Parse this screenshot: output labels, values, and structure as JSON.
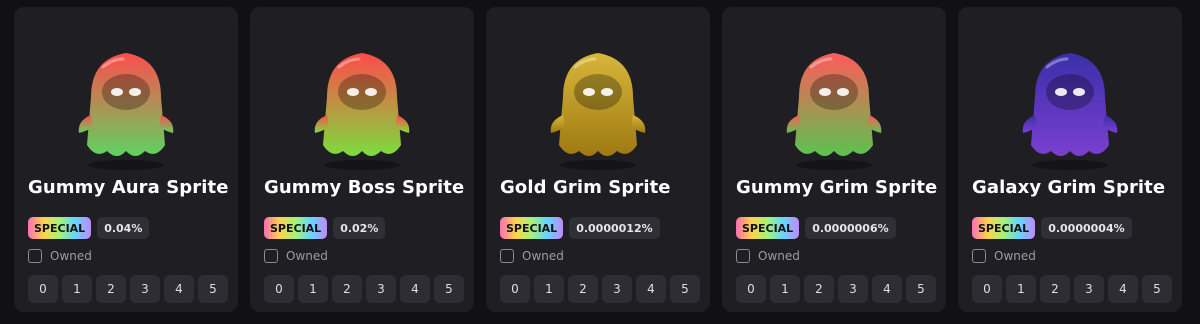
{
  "cards": [
    {
      "name": "Gummy Aura Sprite",
      "badge": "SPECIAL",
      "rarity": "0.04%",
      "owned_label": "Owned",
      "levels": [
        "0",
        "1",
        "2",
        "3",
        "4",
        "5"
      ],
      "art_icon": "gummy-aura-sprite-icon",
      "colors": {
        "top": "#ff4d4d",
        "bottom": "#5fd35f"
      }
    },
    {
      "name": "Gummy Boss Sprite",
      "badge": "SPECIAL",
      "rarity": "0.02%",
      "owned_label": "Owned",
      "levels": [
        "0",
        "1",
        "2",
        "3",
        "4",
        "5"
      ],
      "art_icon": "gummy-boss-sprite-icon",
      "colors": {
        "top": "#ff4a4a",
        "bottom": "#7ddc3d"
      }
    },
    {
      "name": "Gold Grim Sprite",
      "badge": "SPECIAL",
      "rarity": "0.0000012%",
      "owned_label": "Owned",
      "levels": [
        "0",
        "1",
        "2",
        "3",
        "4",
        "5"
      ],
      "art_icon": "gold-grim-sprite-icon",
      "colors": {
        "top": "#d8b63a",
        "bottom": "#9e7a12"
      }
    },
    {
      "name": "Gummy Grim Sprite",
      "badge": "SPECIAL",
      "rarity": "0.0000006%",
      "owned_label": "Owned",
      "levels": [
        "0",
        "1",
        "2",
        "3",
        "4",
        "5"
      ],
      "art_icon": "gummy-grim-sprite-icon",
      "colors": {
        "top": "#ff5a5a",
        "bottom": "#5cc34f"
      }
    },
    {
      "name": "Galaxy Grim Sprite",
      "badge": "SPECIAL",
      "rarity": "0.0000004%",
      "owned_label": "Owned",
      "levels": [
        "0",
        "1",
        "2",
        "3",
        "4",
        "5"
      ],
      "art_icon": "galaxy-grim-sprite-icon",
      "colors": {
        "top": "#3a2fa8",
        "bottom": "#7a3fd0"
      }
    }
  ]
}
